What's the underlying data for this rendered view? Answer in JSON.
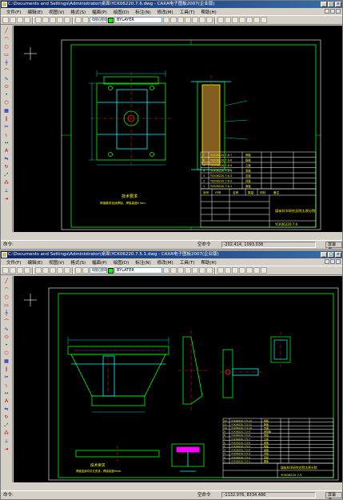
{
  "windows": [
    {
      "title": "C:\\Documents and Settings\\Administrator\\桌面\\YCK06220.7.6.dwg - CAXA电子图板2007(企业版)",
      "menus": [
        "文件(F)",
        "编辑(E)",
        "视图(V)",
        "格式(S)",
        "幅面(P)",
        "绘图(D)",
        "标注(N)",
        "修改(M)",
        "工具(T)",
        "帮助(H)"
      ],
      "layer_combo": "0层(层0)",
      "linetype_combo": "BYLAYER",
      "command_prompt": "命令:",
      "coordinates": "-202.414, 1093.038",
      "mode": "空命令",
      "snap_mode": "屏幕点",
      "drawing": {
        "tech_req_title": "技术要求",
        "tech_req_text": "焊缝要求连续焊接，焊接高度Ⅱ mm.",
        "company": "煤炭科学研究总院太原分院",
        "drawing_no": "YCK06220.7.6",
        "bom_rows": [
          [
            "7",
            "YCK06220.7.6-7",
            "侧板",
            "2",
            "Q235-A",
            ""
          ],
          [
            "6",
            "YCK06220.7.6-6",
            "筋板",
            "4",
            "Q235-A",
            ""
          ],
          [
            "5",
            "YCK06220.7.6-5",
            "立板",
            "2",
            "Q235-A",
            ""
          ],
          [
            "4",
            "YCK06220.7.6-4",
            "底板",
            "1",
            "Q235-A",
            ""
          ],
          [
            "3",
            "YCK06220.7.6-3",
            "支板",
            "2",
            "Q235-A",
            ""
          ],
          [
            "2",
            "YCK06220.7.6-2",
            "耳板",
            "2",
            "Q235-A",
            ""
          ],
          [
            "1",
            "YCK06220.7.6-1",
            "面板",
            "1",
            "Q235-A",
            ""
          ]
        ],
        "title_block_headers": [
          "序号",
          "代号",
          "名称",
          "数量",
          "材料",
          "备注"
        ]
      }
    },
    {
      "title": "C:\\Documents and Settings\\Administrator\\桌面\\YCK06220.7.5.1.dwg - CAXA电子图板2007(企业版)",
      "menus": [
        "文件(F)",
        "编辑(E)",
        "视图(V)",
        "格式(S)",
        "幅面(P)",
        "绘图(D)",
        "标注(N)",
        "修改(M)",
        "工具(T)",
        "帮助(H)"
      ],
      "layer_combo": "0层(层0)",
      "linetype_combo": "BYLATER",
      "command_prompt": "命令:",
      "coordinates": "-1132.976, 8334.486",
      "mode": "空命令",
      "snap_mode": "屏幕点",
      "drawing": {
        "tech_req_title": "技术要求",
        "tech_req_text": "焊缝连续均匀无夹渣，焊接高度6mm.",
        "company": "煤炭科学研究总院太原分院",
        "drawing_no": "YCK06220.7.5",
        "bom_rows": [
          [
            "12",
            "YCK06220.7.5-12",
            "挡板",
            "2",
            "Q235-A",
            ""
          ],
          [
            "11",
            "YCK06220.7.5-11",
            "筋板",
            "4",
            "Q235-A",
            ""
          ],
          [
            "10",
            "YCK06220.7.5-10",
            "支座",
            "2",
            "Q235-A",
            ""
          ],
          [
            "9",
            "YCK06220.7.5-9",
            "连接板",
            "1",
            "Q235-A",
            ""
          ],
          [
            "8",
            "YCK06220.7.5-8",
            "侧板",
            "2",
            "Q235-A",
            ""
          ],
          [
            "7",
            "YCK06220.7.5-7",
            "立板",
            "2",
            "Q235-A",
            ""
          ],
          [
            "6",
            "YCK06220.7.5-6",
            "底板",
            "1",
            "Q235-A",
            ""
          ],
          [
            "5",
            "YCK06220.7.5-5",
            "隔板",
            "2",
            "Q235-A",
            ""
          ],
          [
            "4",
            "YCK06220.7.5-4",
            "盖板",
            "1",
            "Q235-A",
            ""
          ],
          [
            "3",
            "YCK06220.7.5-3",
            "支板",
            "2",
            "Q235-A",
            ""
          ],
          [
            "2",
            "YCK06220.7.5-2",
            "耳板",
            "2",
            "Q235-A",
            ""
          ],
          [
            "1",
            "YCK06220.7.5-1",
            "面板",
            "1",
            "Q235-A",
            ""
          ]
        ]
      }
    }
  ],
  "colors": {
    "frame": "#ffffff",
    "outline": "#00ff00",
    "cyan": "#00ffff",
    "yellow": "#ffff00",
    "red": "#ff2020",
    "magenta": "#ff00ff"
  }
}
